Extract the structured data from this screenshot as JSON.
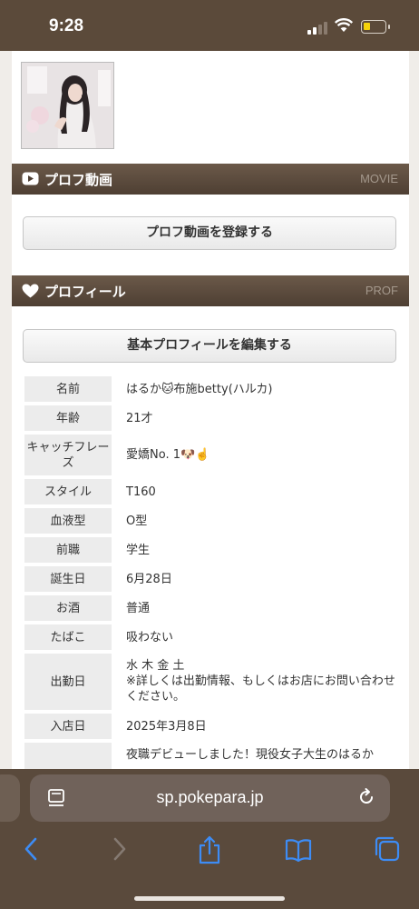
{
  "status": {
    "time": "9:28"
  },
  "sections": {
    "movie": {
      "title": "プロフ動画",
      "sub": "MOVIE",
      "button": "プロフ動画を登録する"
    },
    "prof": {
      "title": "プロフィール",
      "sub": "PROF",
      "button": "基本プロフィールを編集する"
    }
  },
  "profile": [
    {
      "label": "名前",
      "value": "はるか🐱布施betty(ハルカ)"
    },
    {
      "label": "年齢",
      "value": "21才"
    },
    {
      "label": "キャッチフレーズ",
      "value": "愛嬌No. 1🐶☝️"
    },
    {
      "label": "スタイル",
      "value": "T160"
    },
    {
      "label": "血液型",
      "value": "O型"
    },
    {
      "label": "前職",
      "value": "学生"
    },
    {
      "label": "誕生日",
      "value": "6月28日"
    },
    {
      "label": "お酒",
      "value": "普通"
    },
    {
      "label": "たばこ",
      "value": "吸わない"
    },
    {
      "label": "出勤日",
      "value": "水 木 金 土\n※詳しくは出勤情報、もしくはお店にお問い合わせください。"
    },
    {
      "label": "入店日",
      "value": "2025年3月8日"
    },
    {
      "label": "",
      "value": "夜職デビューしました！現役女子大生のはるか"
    }
  ],
  "browser": {
    "url": "sp.pokepara.jp"
  }
}
